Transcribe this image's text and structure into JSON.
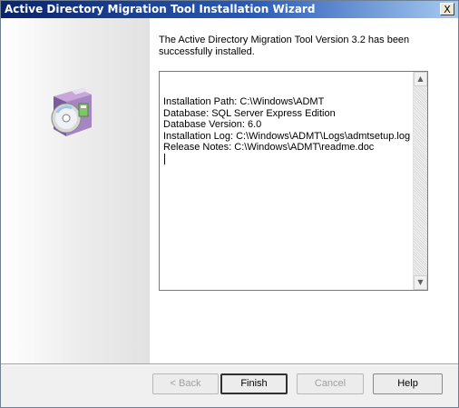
{
  "window": {
    "title": "Active Directory Migration Tool Installation Wizard",
    "close_glyph": "X"
  },
  "icon": {
    "name": "installer-package-icon"
  },
  "message": "The Active Directory Migration Tool Version 3.2 has been successfully installed.",
  "details": {
    "lines": [
      "Installation Path: C:\\Windows\\ADMT",
      "Database: SQL Server Express Edition",
      "Database Version: 6.0",
      "Installation Log: C:\\Windows\\ADMT\\Logs\\admtsetup.log",
      "Release Notes: C:\\Windows\\ADMT\\readme.doc"
    ]
  },
  "scrollbar": {
    "up_glyph": "▲",
    "down_glyph": "▼"
  },
  "buttons": {
    "back": "< Back",
    "finish": "Finish",
    "cancel": "Cancel",
    "help": "Help"
  },
  "colors": {
    "titlebar_start": "#0a246a",
    "titlebar_end": "#a6caf0"
  }
}
